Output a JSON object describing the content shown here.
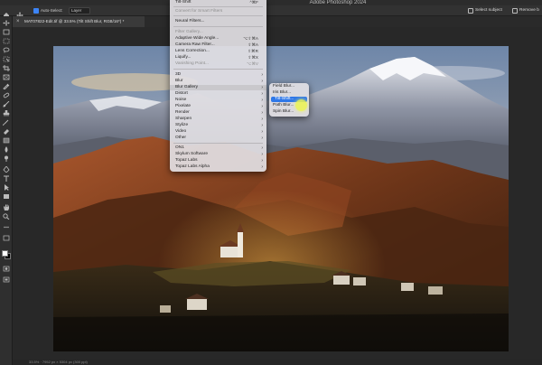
{
  "window": {
    "title": "Adobe Photoshop 2024"
  },
  "options_bar": {
    "auto_select_label": "Auto-Select:",
    "layer_value": "Layer",
    "select_subject_label": "Select subject",
    "remove_bg_label": "Remove b"
  },
  "document_tab": {
    "close_glyph": "×",
    "title": "MAT07822-Edit.tif @ 33.5% (Tilt Shift Blur, RGB/16*) *"
  },
  "status": {
    "text": "33.5% ·  7952 px × 5304 px (300 ppi)"
  },
  "filter_menu": {
    "items": [
      {
        "label": "Tilt-Shift",
        "shortcut": "^⌘F",
        "disabled": false
      },
      {
        "label": "Convert for Smart Filters",
        "shortcut": "",
        "disabled": true
      },
      {
        "label": "Neural Filters...",
        "shortcut": "",
        "disabled": false
      },
      {
        "label": "Filter Gallery...",
        "shortcut": "",
        "disabled": true
      },
      {
        "label": "Adaptive Wide Angle...",
        "shortcut": "⌥⇧⌘A",
        "disabled": false
      },
      {
        "label": "Camera Raw Filter...",
        "shortcut": "⇧⌘A",
        "disabled": false
      },
      {
        "label": "Lens Correction...",
        "shortcut": "⇧⌘R",
        "disabled": false
      },
      {
        "label": "Liquify...",
        "shortcut": "⇧⌘X",
        "disabled": false
      },
      {
        "label": "Vanishing Point...",
        "shortcut": "⌥⌘V",
        "disabled": true
      },
      {
        "label": "3D",
        "shortcut": "",
        "disabled": false
      },
      {
        "label": "Blur",
        "shortcut": "",
        "disabled": false
      },
      {
        "label": "Blur Gallery",
        "shortcut": "",
        "disabled": false
      },
      {
        "label": "Distort",
        "shortcut": "",
        "disabled": false
      },
      {
        "label": "Noise",
        "shortcut": "",
        "disabled": false
      },
      {
        "label": "Pixelate",
        "shortcut": "",
        "disabled": false
      },
      {
        "label": "Render",
        "shortcut": "",
        "disabled": false
      },
      {
        "label": "Sharpen",
        "shortcut": "",
        "disabled": false
      },
      {
        "label": "Stylize",
        "shortcut": "",
        "disabled": false
      },
      {
        "label": "Video",
        "shortcut": "",
        "disabled": false
      },
      {
        "label": "Other",
        "shortcut": "",
        "disabled": false
      },
      {
        "label": "ON1",
        "shortcut": "",
        "disabled": false
      },
      {
        "label": "Skylum Software",
        "shortcut": "",
        "disabled": false
      },
      {
        "label": "Topaz Labs",
        "shortcut": "",
        "disabled": false
      },
      {
        "label": "Topaz Labs Alpha",
        "shortcut": "",
        "disabled": false
      }
    ],
    "submenu_arrow": "›"
  },
  "blur_gallery_submenu": {
    "items": [
      "Field Blur...",
      "Iris Blur...",
      "Tilt-Shift...",
      "Path Blur...",
      "Spin Blur..."
    ],
    "selected": "Tilt-Shift..."
  },
  "colors": {
    "accent": "#2f78e8",
    "highlight": "#ecf550",
    "foreground_swatch": "#ffffff",
    "background_swatch": "#000000"
  }
}
